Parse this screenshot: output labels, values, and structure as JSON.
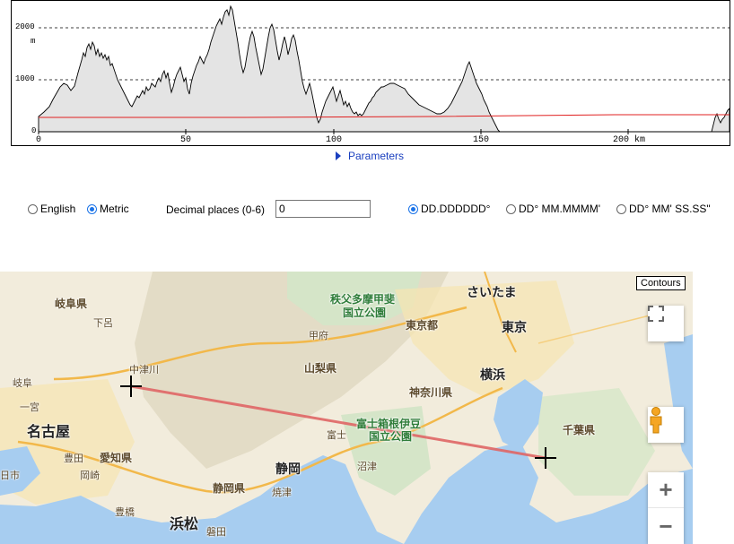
{
  "profile": {
    "y_unit": "m",
    "y_ticks": [
      "2000",
      "1000",
      "0"
    ],
    "x_ticks": [
      "0",
      "50",
      "100",
      "150",
      "200 km"
    ],
    "colors": {
      "terrain_fill": "#e4e4e4",
      "terrain_line": "#000000",
      "path_line": "#e02020",
      "grid": "#000000"
    }
  },
  "parameters_link": "Parameters",
  "units": {
    "english_label": "English",
    "metric_label": "Metric",
    "selected": "Metric"
  },
  "decimal": {
    "label": "Decimal places (0-6)",
    "value": "0"
  },
  "coord_format": {
    "options": [
      "DD.DDDDDD°",
      "DD° MM.MMMM'",
      "DD° MM' SS.SS\""
    ],
    "selected": "DD.DDDDDD°"
  },
  "map": {
    "contours_button": "Contours",
    "fullscreen_icon": "fullscreen-icon",
    "pegman_icon": "pegman-icon",
    "zoom_in": "+",
    "zoom_out": "−",
    "route_color": "#e06666",
    "places": {
      "gifu_pref": "岐阜県",
      "shimoro": "下呂",
      "nakatsugawa": "中津川",
      "gifu": "岐阜",
      "ichinomiya": "一宮",
      "nagoya": "名古屋",
      "toyota": "豊田",
      "aichi_pref": "愛知県",
      "okazaki": "岡崎",
      "toyohashi": "豊橋",
      "hamamatsu": "浜松",
      "iwata": "磐田",
      "shi": "日市",
      "chichibu_park_1": "秩父多摩甲斐",
      "chichibu_park_2": "国立公園",
      "kofu": "甲府",
      "yamanashi_pref": "山梨県",
      "fuji": "富士",
      "shizuoka": "静岡",
      "shizuoka_pref": "静岡県",
      "yaizu": "焼津",
      "numazu": "沼津",
      "fuji_park_1": "富士箱根伊豆",
      "fuji_park_2": "国立公園",
      "saitama": "さいたま",
      "tokyo_to": "東京都",
      "tokyo": "東京",
      "yokohama": "横浜",
      "kanagawa_pref": "神奈川県",
      "chiba_pref": "千葉県"
    }
  }
}
